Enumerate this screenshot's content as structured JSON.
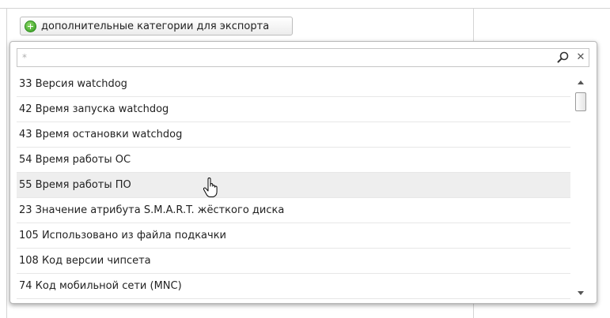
{
  "toolbar": {
    "add_categories_label": "дополнительные категории для экспорта"
  },
  "search": {
    "placeholder": "*",
    "value": ""
  },
  "icons": {
    "add": "plus-circle-icon",
    "search": "search-icon",
    "clear": "close-icon",
    "cursor": "hand-pointer-icon"
  },
  "list": {
    "items": [
      "33  Версия watchdog",
      "42  Время запуска watchdog",
      "43  Время остановки watchdog",
      "54  Время работы ОС",
      "55  Время работы ПО",
      "23  Значение атрибута S.M.A.R.T. жёсткого диска",
      "105  Использовано из файла подкачки",
      "108  Код версии чипсета",
      "74  Код мобильной сети (MNC)"
    ],
    "hovered_item": "55  Время работы ПО"
  },
  "colors": {
    "accent_green": "#2e9a1c",
    "hover_bg": "#eeeeee",
    "border": "#b9b9b9"
  }
}
